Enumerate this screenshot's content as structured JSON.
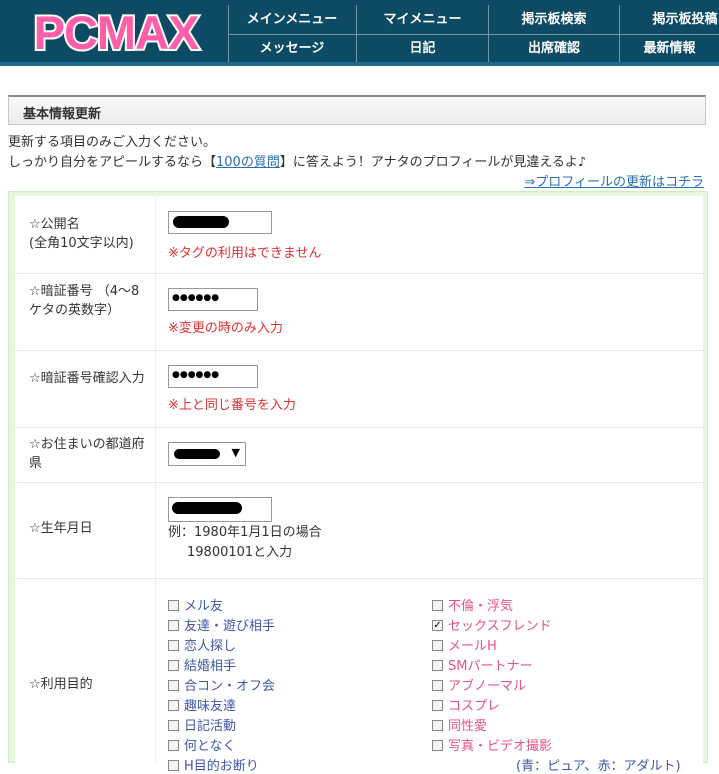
{
  "logo": {
    "text": "PCMAX"
  },
  "nav": {
    "top": [
      "メインメニュー",
      "マイメニュー",
      "掲示板検索",
      "掲示板投稿"
    ],
    "bottom": [
      "メッセージ",
      "日記",
      "出席確認",
      "最新情報"
    ]
  },
  "section": {
    "title": "基本情報更新"
  },
  "intro": {
    "line1": "更新する項目のみご入力ください。",
    "line2_pre": "しっかり自分をアピールするなら【",
    "line2_link": "100の質問",
    "line2_post": "】に答えよう！アナタのプロフィールが見違えるよ♪",
    "profile_link": "⇒プロフィールの更新はコチラ"
  },
  "form": {
    "nickname": {
      "label": "☆公開名\n(全角10文字以内)",
      "note": "※タグの利用はできません"
    },
    "pin": {
      "label": "☆暗証番号\n（4～8ケタの英数字）",
      "value": "●●●●●●",
      "note": "※変更の時のみ入力"
    },
    "pin_confirm": {
      "label": "☆暗証番号確認入力",
      "value": "●●●●●●",
      "note": "※上と同じ番号を入力"
    },
    "prefecture": {
      "label": "☆お住まいの都道府県",
      "arrow": "▼"
    },
    "birthday": {
      "label": "☆生年月日",
      "hint1": "例：1980年1月1日の場合",
      "hint2": "19800101と入力"
    },
    "purpose": {
      "label": "☆利用目的",
      "left": [
        "メル友",
        "友達・遊び相手",
        "恋人探し",
        "結婚相手",
        "合コン・オフ会",
        "趣味友達",
        "日記活動",
        "何となく",
        "H目的お断り"
      ],
      "right": [
        "不倫・浮気",
        "セックスフレンド",
        "メールH",
        "SMパートナー",
        "アブノーマル",
        "コスプレ",
        "同性愛",
        "写真・ビデオ撮影"
      ],
      "right_checked_index": 1,
      "legend": "(青：ピュア、赤：アダルト)"
    }
  }
}
